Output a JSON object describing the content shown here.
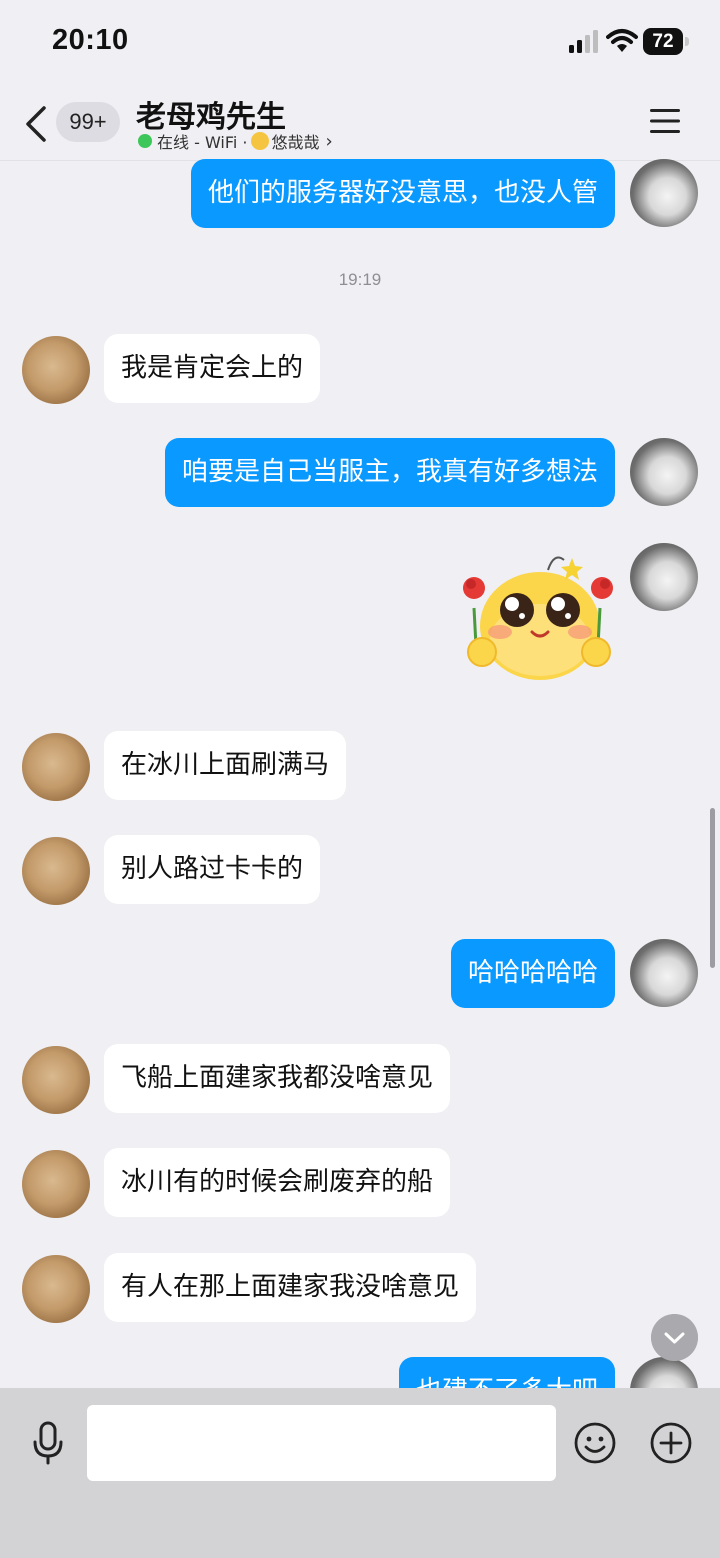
{
  "status_bar": {
    "time": "20:10",
    "battery": "72"
  },
  "header": {
    "unread_count": "99+",
    "contact_name": "老母鸡先生",
    "presence": "在线 - WiFi ·",
    "mood_text": "悠哉哉",
    "chevron": "›"
  },
  "chat": {
    "time_divider": "19:19",
    "messages": [
      {
        "side": "out",
        "text": "他们的服务器好没意思，也没人管"
      },
      {
        "side": "in",
        "text": "我是肯定会上的"
      },
      {
        "side": "out",
        "text": "咱要是自己当服主，我真有好多想法"
      },
      {
        "side": "out",
        "type": "sticker",
        "sticker": "cute-chick-with-roses-sticker"
      },
      {
        "side": "in",
        "text": "在冰川上面刷满马"
      },
      {
        "side": "in",
        "text": "别人路过卡卡的"
      },
      {
        "side": "out",
        "text": "哈哈哈哈哈"
      },
      {
        "side": "in",
        "text": "飞船上面建家我都没啥意见"
      },
      {
        "side": "in",
        "text": "冰川有的时候会刷废弃的船"
      },
      {
        "side": "in",
        "text": "有人在那上面建家我没啥意见"
      },
      {
        "side": "out",
        "text": "也建不了多大吧",
        "partially_visible": true
      }
    ]
  },
  "input_bar": {
    "placeholder": ""
  },
  "colors": {
    "outgoing_bubble": "#0a99ff",
    "incoming_bubble": "#ffffff",
    "background": "#efeff4",
    "input_bar": "#d3d3d6"
  }
}
